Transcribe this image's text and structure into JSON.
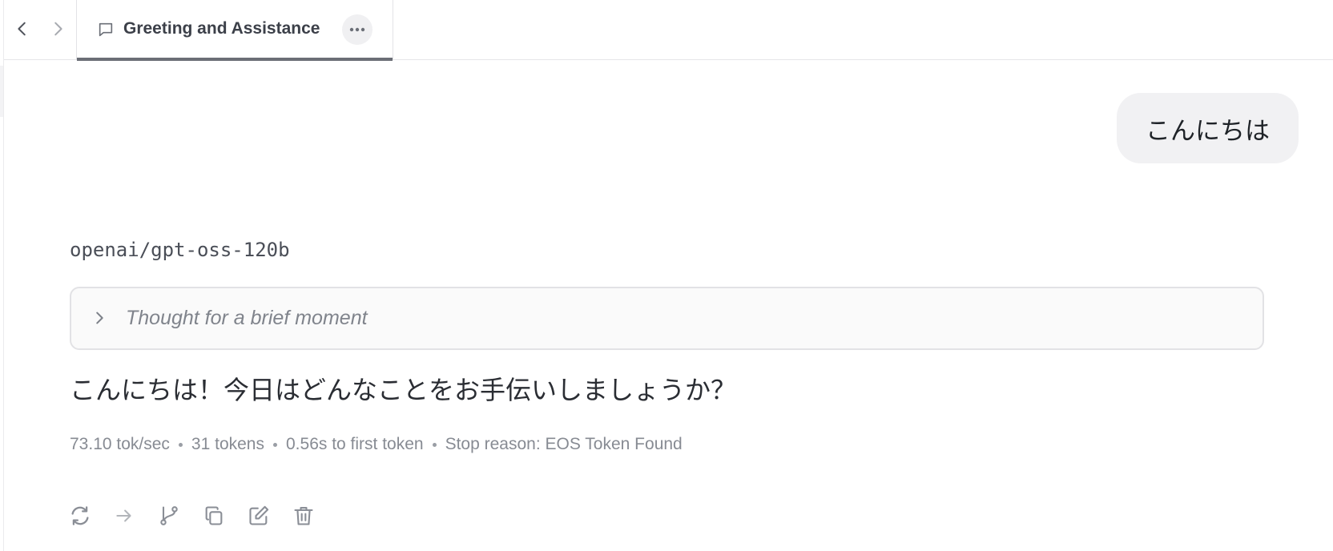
{
  "tab": {
    "title": "Greeting and Assistance",
    "more_icon": "more-horizontal-icon",
    "chat_icon": "chat-bubble-icon"
  },
  "nav": {
    "back_icon": "chevron-left-icon",
    "forward_icon": "chevron-right-icon"
  },
  "conversation": {
    "user_message": "こんにちは",
    "model_name": "openai/gpt-oss-120b",
    "thought_label": "Thought for a brief moment",
    "assistant_reply": "こんにちは！今日はどんなことをお手伝いしましょうか？"
  },
  "stats": {
    "speed": "73.10 tok/sec",
    "tokens": "31 tokens",
    "first_token": "0.56s to first token",
    "stop_reason": "Stop reason: EOS Token Found"
  },
  "actions": [
    {
      "icon": "regenerate-icon"
    },
    {
      "icon": "continue-arrow-icon"
    },
    {
      "icon": "branch-icon"
    },
    {
      "icon": "copy-icon"
    },
    {
      "icon": "edit-icon"
    },
    {
      "icon": "delete-icon"
    }
  ],
  "colors": {
    "tab_underline": "#6b6e76",
    "user_bubble_bg": "#f1f1f3",
    "muted_text": "#878b93",
    "icon_gray": "#8a8e96"
  }
}
